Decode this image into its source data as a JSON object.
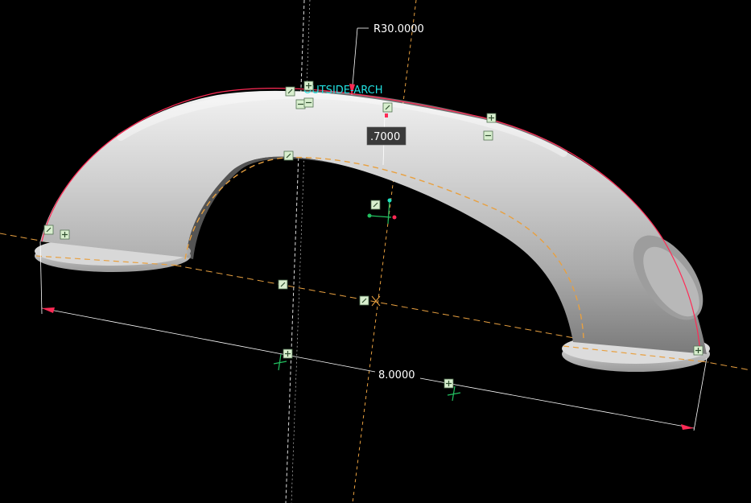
{
  "viewport": {
    "background": "#000000",
    "part_color": "#c8c8c8",
    "sketch_color": "#ff2a55",
    "dimension_color": "#ffffff",
    "reference_color": "#e8a040",
    "label_color": "#22e0e0",
    "marker_color": "#d9efcf"
  },
  "labels": {
    "arch_label": "OUTSIDE-ARCH"
  },
  "dimensions": {
    "radius": "R30.0000",
    "thickness": ".7000",
    "length": "8.0000"
  },
  "icons": {
    "constraint_marker": "constraint-square-icon",
    "csys_marker": "coordinate-system-icon"
  }
}
